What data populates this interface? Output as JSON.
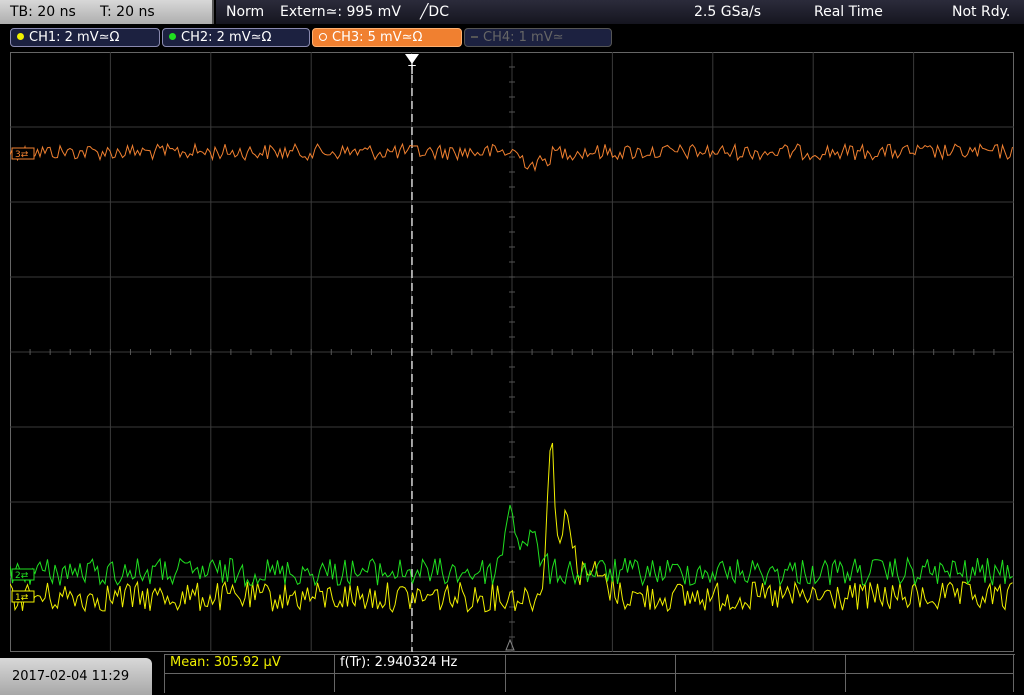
{
  "topbar": {
    "timebase": "TB: 20 ns",
    "trigger_time": "T: 20 ns",
    "mode": "Norm",
    "trigger_source": "Extern≃: 995 mV",
    "trigger_slope": "╱DC",
    "sample_rate": "2.5 GSa/s",
    "acq_mode": "Real Time",
    "status": "Not Rdy."
  },
  "channels": [
    {
      "label": "CH1: 2 mV≃Ω",
      "color": "#f0f000"
    },
    {
      "label": "CH2: 2 mV≃Ω",
      "color": "#20e020"
    },
    {
      "label": "CH3: 5 mV≃Ω",
      "color": "#f08030"
    },
    {
      "label": "CH4: 1 mV≃",
      "color": "#666666"
    }
  ],
  "measurements": {
    "mean": "Mean: 305.92 µV",
    "freq": "f(Tr): 2.940324 Hz"
  },
  "datetime": "2017-02-04 11:29",
  "trace_markers": {
    "ch3": "3⇄",
    "ch2": "2⇄",
    "ch1": "1⇄"
  },
  "trigger_marker": "T",
  "colors": {
    "ch1": "#f0f000",
    "ch2": "#20e020",
    "ch3": "#f08030",
    "grid": "#3a3a3a",
    "cursor": "#ffffff"
  }
}
